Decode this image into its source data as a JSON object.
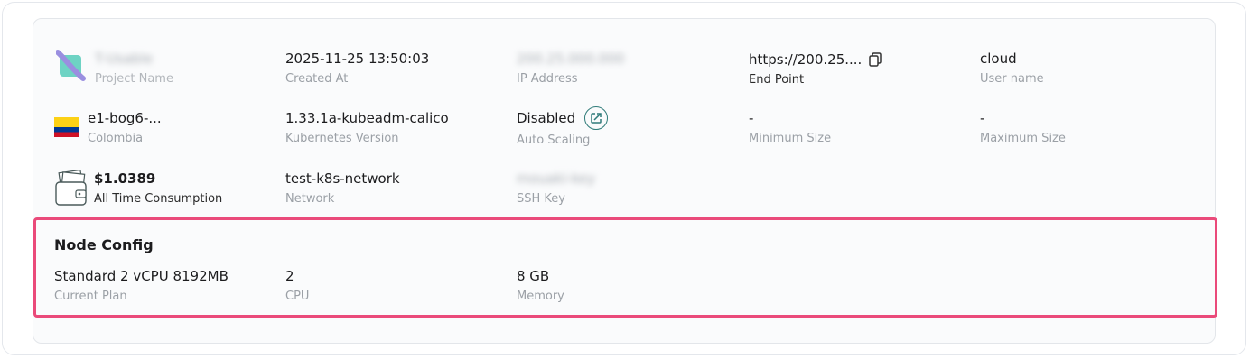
{
  "row1": {
    "project_name": {
      "value": "T-Usable",
      "label": "Project Name"
    },
    "created_at": {
      "value": "2025-11-25 13:50:03",
      "label": "Created At"
    },
    "ip_address": {
      "value": "200.25.000.000",
      "label": "IP Address"
    },
    "end_point": {
      "value": "https://200.25....",
      "label": "End Point"
    },
    "user_name": {
      "value": "cloud",
      "label": "User name"
    }
  },
  "row2": {
    "region": {
      "value": "e1-bog6-...",
      "label": "Colombia"
    },
    "kubernetes_version": {
      "value": "1.33.1a-kubeadm-calico",
      "label": "Kubernetes Version"
    },
    "auto_scaling": {
      "value": "Disabled",
      "label": "Auto Scaling"
    },
    "minimum_size": {
      "value": "-",
      "label": "Minimum Size"
    },
    "maximum_size": {
      "value": "-",
      "label": "Maximum Size"
    }
  },
  "row3": {
    "consumption": {
      "value": "$1.0389",
      "label": "All Time Consumption"
    },
    "network": {
      "value": "test-k8s-network",
      "label": "Network"
    },
    "ssh_key": {
      "value": "mouaki-key",
      "label": "SSH Key"
    }
  },
  "node_config": {
    "title": "Node Config",
    "current_plan": {
      "value": "Standard 2 vCPU 8192MB",
      "label": "Current Plan"
    },
    "cpu": {
      "value": "2",
      "label": "CPU"
    },
    "memory": {
      "value": "8 GB",
      "label": "Memory"
    }
  },
  "colors": {
    "highlight": "#ea4a7a",
    "accent_teal": "#2f7b79",
    "flag_yellow": "#fcd116",
    "flag_blue": "#003893",
    "flag_red": "#ce1126"
  },
  "icons": [
    "project-logo-icon",
    "copy-icon",
    "colombia-flag-icon",
    "edit-autoscale-icon",
    "wallet-icon"
  ]
}
